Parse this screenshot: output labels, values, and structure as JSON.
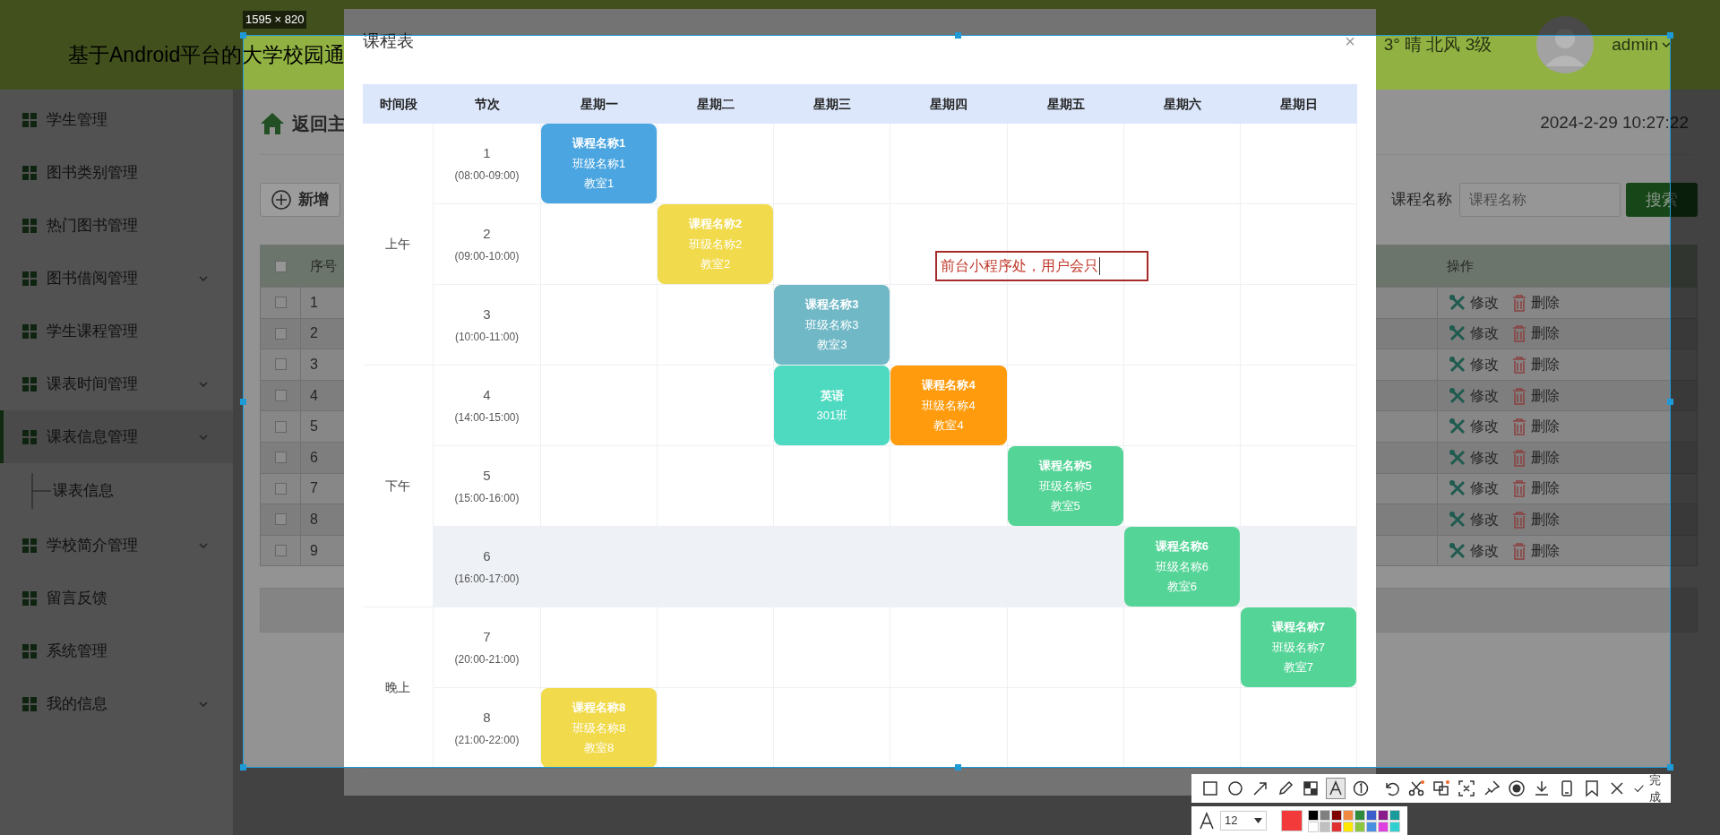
{
  "header": {
    "title": "基于Android平台的大学校园通",
    "weather": "3° 晴 北风 3级",
    "user": "admin"
  },
  "sidebar": {
    "items": [
      {
        "label": "学生管理",
        "selected": false,
        "collapsible": false
      },
      {
        "label": "图书类别管理",
        "selected": false,
        "collapsible": false
      },
      {
        "label": "热门图书管理",
        "selected": false,
        "collapsible": false
      },
      {
        "label": "图书借阅管理",
        "selected": false,
        "collapsible": true
      },
      {
        "label": "学生课程管理",
        "selected": false,
        "collapsible": false
      },
      {
        "label": "课表时间管理",
        "selected": false,
        "collapsible": true
      },
      {
        "label": "课表信息管理",
        "selected": true,
        "collapsible": true,
        "children": [
          {
            "label": "课表信息",
            "selected": false
          }
        ]
      },
      {
        "label": "学校简介管理",
        "selected": false,
        "collapsible": true
      },
      {
        "label": "留言反馈",
        "selected": false,
        "collapsible": false
      },
      {
        "label": "系统管理",
        "selected": false,
        "collapsible": false
      },
      {
        "label": "我的信息",
        "selected": false,
        "collapsible": true
      }
    ]
  },
  "content": {
    "breadcrumb": "返回主",
    "datetime": "2024-2-29 10:27:22",
    "add_button": "新增",
    "search": {
      "label": "课程名称",
      "placeholder": "课程名称",
      "button": "搜索"
    },
    "table": {
      "header_checked": false,
      "columns": [
        "序号",
        "操作"
      ],
      "rows": [
        {
          "number": "1",
          "checked": false,
          "actions": [
            "修改",
            "删除"
          ]
        },
        {
          "number": "2",
          "checked": false,
          "actions": [
            "修改",
            "删除"
          ]
        },
        {
          "number": "3",
          "checked": false,
          "actions": [
            "修改",
            "删除"
          ]
        },
        {
          "number": "4",
          "checked": false,
          "actions": [
            "修改",
            "删除"
          ]
        },
        {
          "number": "5",
          "checked": false,
          "actions": [
            "修改",
            "删除"
          ]
        },
        {
          "number": "6",
          "checked": false,
          "actions": [
            "修改",
            "删除"
          ]
        },
        {
          "number": "7",
          "checked": false,
          "actions": [
            "修改",
            "删除"
          ]
        },
        {
          "number": "8",
          "checked": false,
          "actions": [
            "修改",
            "删除"
          ]
        },
        {
          "number": "9",
          "checked": false,
          "actions": [
            "修改",
            "删除"
          ]
        }
      ]
    }
  },
  "modal": {
    "title": "课程表",
    "close": "×",
    "timetable": {
      "columns": [
        "时间段",
        "节次",
        "星期一",
        "星期二",
        "星期三",
        "星期四",
        "星期五",
        "星期六",
        "星期日"
      ],
      "periods": [
        {
          "label": "上午",
          "slots": [
            {
              "number": "1",
              "time": "(08:00-09:00)",
              "hovered": false,
              "cells": [
                {
                  "kind": "course",
                  "color": "#4aa5e0",
                  "lines": [
                    "课程名称1",
                    "班级名称1",
                    "教室1"
                  ]
                },
                {
                  "kind": "empty"
                },
                {
                  "kind": "empty"
                },
                {
                  "kind": "empty"
                },
                {
                  "kind": "empty"
                },
                {
                  "kind": "empty"
                },
                {
                  "kind": "empty"
                }
              ]
            },
            {
              "number": "2",
              "time": "(09:00-10:00)",
              "hovered": false,
              "cells": [
                {
                  "kind": "empty"
                },
                {
                  "kind": "course",
                  "color": "#f1da4c",
                  "lines": [
                    "课程名称2",
                    "班级名称2",
                    "教室2"
                  ]
                },
                {
                  "kind": "empty"
                },
                {
                  "kind": "empty"
                },
                {
                  "kind": "empty"
                },
                {
                  "kind": "empty"
                },
                {
                  "kind": "empty"
                }
              ]
            },
            {
              "number": "3",
              "time": "(10:00-11:00)",
              "hovered": false,
              "cells": [
                {
                  "kind": "empty"
                },
                {
                  "kind": "empty"
                },
                {
                  "kind": "course",
                  "color": "#70b8c6",
                  "lines": [
                    "课程名称3",
                    "班级名称3",
                    "教室3"
                  ]
                },
                {
                  "kind": "empty"
                },
                {
                  "kind": "empty"
                },
                {
                  "kind": "empty"
                },
                {
                  "kind": "empty"
                }
              ]
            }
          ]
        },
        {
          "label": "下午",
          "slots": [
            {
              "number": "4",
              "time": "(14:00-15:00)",
              "hovered": false,
              "cells": [
                {
                  "kind": "empty"
                },
                {
                  "kind": "empty"
                },
                {
                  "kind": "course",
                  "color": "#4ed9c1",
                  "lines": [
                    "英语",
                    "301班"
                  ]
                },
                {
                  "kind": "course",
                  "color": "#ff9b0c",
                  "lines": [
                    "课程名称4",
                    "班级名称4",
                    "教室4"
                  ]
                },
                {
                  "kind": "empty"
                },
                {
                  "kind": "empty"
                },
                {
                  "kind": "empty"
                }
              ]
            },
            {
              "number": "5",
              "time": "(15:00-16:00)",
              "hovered": false,
              "cells": [
                {
                  "kind": "empty"
                },
                {
                  "kind": "empty"
                },
                {
                  "kind": "empty"
                },
                {
                  "kind": "empty"
                },
                {
                  "kind": "course",
                  "color": "#55d497",
                  "lines": [
                    "课程名称5",
                    "班级名称5",
                    "教室5"
                  ]
                },
                {
                  "kind": "empty"
                },
                {
                  "kind": "empty"
                }
              ]
            },
            {
              "number": "6",
              "time": "(16:00-17:00)",
              "hovered": true,
              "cells": [
                {
                  "kind": "empty"
                },
                {
                  "kind": "empty"
                },
                {
                  "kind": "empty"
                },
                {
                  "kind": "empty"
                },
                {
                  "kind": "empty"
                },
                {
                  "kind": "course",
                  "color": "#55d497",
                  "lines": [
                    "课程名称6",
                    "班级名称6",
                    "教室6"
                  ]
                },
                {
                  "kind": "empty"
                }
              ]
            }
          ]
        },
        {
          "label": "晚上",
          "slots": [
            {
              "number": "7",
              "time": "(20:00-21:00)",
              "hovered": false,
              "cells": [
                {
                  "kind": "empty"
                },
                {
                  "kind": "empty"
                },
                {
                  "kind": "empty"
                },
                {
                  "kind": "empty"
                },
                {
                  "kind": "empty"
                },
                {
                  "kind": "empty"
                },
                {
                  "kind": "course",
                  "color": "#55d497",
                  "lines": [
                    "课程名称7",
                    "班级名称7",
                    "教室7"
                  ]
                }
              ]
            },
            {
              "number": "8",
              "time": "(21:00-22:00)",
              "hovered": false,
              "cells": [
                {
                  "kind": "course",
                  "color": "#f1da4c",
                  "lines": [
                    "课程名称8",
                    "班级名称8",
                    "教室8"
                  ]
                },
                {
                  "kind": "empty"
                },
                {
                  "kind": "empty"
                },
                {
                  "kind": "empty"
                },
                {
                  "kind": "empty"
                },
                {
                  "kind": "empty"
                },
                {
                  "kind": "empty"
                }
              ]
            }
          ]
        }
      ]
    }
  },
  "annotation": {
    "text": "前台小程序处，用户会只"
  },
  "selection": {
    "size_label": "1595 × 820"
  },
  "toolbar": {
    "tools": [
      {
        "kind": "rectangle",
        "selected": false
      },
      {
        "kind": "ellipse",
        "selected": false
      },
      {
        "kind": "arrow",
        "selected": false
      },
      {
        "kind": "pencil",
        "selected": false
      },
      {
        "kind": "mosaic",
        "selected": false
      },
      {
        "kind": "text",
        "selected": true
      },
      {
        "kind": "counter",
        "selected": false
      },
      {
        "kind": "undo",
        "selected": false
      },
      {
        "kind": "scissors",
        "selected": false
      },
      {
        "kind": "translate",
        "selected": false
      },
      {
        "kind": "scan",
        "selected": false
      },
      {
        "kind": "pin",
        "selected": false
      },
      {
        "kind": "record",
        "selected": false
      },
      {
        "kind": "download",
        "selected": false
      },
      {
        "kind": "phone",
        "selected": false
      },
      {
        "kind": "bookmark",
        "selected": false
      },
      {
        "kind": "close",
        "selected": false
      }
    ],
    "done": "完成"
  },
  "text_options": {
    "font_size": "12",
    "current_swatch": {
      "color": "#f23a3a"
    },
    "palette": [
      {
        "color": "#000000"
      },
      {
        "color": "#808080"
      },
      {
        "color": "#800000"
      },
      {
        "color": "#f08a40"
      },
      {
        "color": "#2e8b3e"
      },
      {
        "color": "#3a5fcd"
      },
      {
        "color": "#8b1a8b"
      },
      {
        "color": "#1a9a9a"
      },
      {
        "color": "#ffffff"
      },
      {
        "color": "#c0c0c0"
      },
      {
        "color": "#e03030"
      },
      {
        "color": "#ffe800"
      },
      {
        "color": "#8cc63f"
      },
      {
        "color": "#4a90e2"
      },
      {
        "color": "#e040e0"
      },
      {
        "color": "#30d0d0"
      }
    ]
  }
}
